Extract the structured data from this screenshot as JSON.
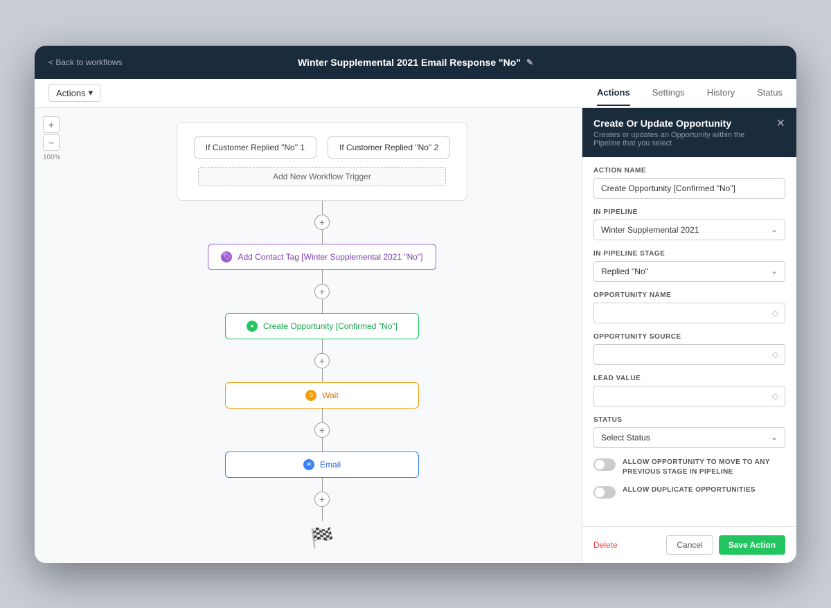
{
  "header": {
    "back_label": "< Back to workflows",
    "title": "Winter Supplemental 2021 Email Response \"No\"",
    "edit_icon": "✎"
  },
  "tabs_bar": {
    "actions_dropdown": "Actions",
    "dropdown_icon": "▾",
    "tabs": [
      {
        "id": "actions",
        "label": "Actions",
        "active": true
      },
      {
        "id": "settings",
        "label": "Settings",
        "active": false
      },
      {
        "id": "history",
        "label": "History",
        "active": false
      },
      {
        "id": "status",
        "label": "Status",
        "active": false
      }
    ]
  },
  "canvas": {
    "zoom_minus": "−",
    "zoom_plus": "+",
    "zoom_level": "100%",
    "trigger_nodes": [
      {
        "label": "If Customer Replied \"No\" 1"
      },
      {
        "label": "If Customer Replied \"No\" 2"
      }
    ],
    "add_trigger_label": "Add New Workflow Trigger",
    "action_nodes": [
      {
        "id": "tag",
        "label": "Add Contact Tag [Winter Supplemental 2021 \"No\"]",
        "icon_type": "purple",
        "icon_symbol": "🏷"
      },
      {
        "id": "opportunity",
        "label": "Create Opportunity [Confirmed \"No\"]",
        "icon_type": "green",
        "icon_symbol": "●"
      },
      {
        "id": "wait",
        "label": "Wait",
        "icon_type": "orange",
        "icon_symbol": "⏱"
      },
      {
        "id": "email",
        "label": "Email",
        "icon_type": "blue",
        "icon_symbol": "✉"
      }
    ],
    "finish_icon": "🏁"
  },
  "right_panel": {
    "title": "Create Or Update Opportunity",
    "subtitle": "Creates or updates an Opportunity within the Pipeline that you select",
    "close_icon": "✕",
    "fields": {
      "action_name_label": "ACTION NAME",
      "action_name_value": "Create Opportunity [Confirmed \"No\"]",
      "in_pipeline_label": "IN PIPELINE",
      "in_pipeline_value": "Winter Supplemental 2021",
      "in_pipeline_stage_label": "IN PIPELINE STAGE",
      "in_pipeline_stage_value": "Replied \"No\"",
      "opportunity_name_label": "OPPORTUNITY NAME",
      "opportunity_name_value": "",
      "opportunity_source_label": "OPPORTUNITY SOURCE",
      "opportunity_source_value": "",
      "lead_value_label": "LEAD VALUE",
      "lead_value_value": "",
      "status_label": "STATUS",
      "status_value": "Select Status",
      "toggle1_label": "ALLOW OPPORTUNITY TO MOVE TO ANY PREVIOUS STAGE IN PIPELINE",
      "toggle2_label": "ALLOW DUPLICATE OPPORTUNITIES"
    },
    "footer": {
      "delete_label": "Delete",
      "cancel_label": "Cancel",
      "save_label": "Save Action"
    }
  }
}
